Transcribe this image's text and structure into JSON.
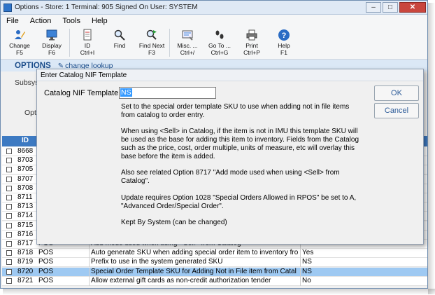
{
  "window": {
    "title": "Options - Store: 1   Terminal: 905   Signed On User: SYSTEM"
  },
  "menu": [
    "File",
    "Action",
    "Tools",
    "Help"
  ],
  "toolbar": [
    {
      "name": "change",
      "icon": "pencil-person-icon",
      "line1": "Change",
      "line2": "F5"
    },
    {
      "name": "display",
      "icon": "monitor-icon",
      "line1": "Display",
      "line2": "F6"
    },
    {
      "name": "id",
      "icon": "id-card-icon",
      "line1": "ID",
      "line2": "Ctrl+I"
    },
    {
      "name": "find",
      "icon": "magnifier-icon",
      "line1": "Find",
      "line2": ""
    },
    {
      "name": "find-next",
      "icon": "magnifier-arrow-icon",
      "line1": "Find Next",
      "line2": "F3"
    },
    {
      "name": "misc",
      "icon": "tools-icon",
      "line1": "Misc. ...",
      "line2": "Ctrl+/"
    },
    {
      "name": "goto",
      "icon": "footsteps-icon",
      "line1": "Go To ...",
      "line2": "Ctrl+G"
    },
    {
      "name": "print",
      "icon": "printer-icon",
      "line1": "Print",
      "line2": "Ctrl+P"
    },
    {
      "name": "help",
      "icon": "help-icon",
      "line1": "Help",
      "line2": "F1"
    }
  ],
  "options_bar": {
    "title": "OPTIONS",
    "link": "change lookup"
  },
  "background_labels": {
    "subsystem": "Subsyst",
    "option": "Opti"
  },
  "grid": {
    "headers": {
      "id": "ID"
    },
    "rows": [
      {
        "id": "8668",
        "sys": "",
        "desc": "",
        "val": ""
      },
      {
        "id": "8703",
        "sys": "",
        "desc": "",
        "val": ""
      },
      {
        "id": "8705",
        "sys": "",
        "desc": "",
        "val": ""
      },
      {
        "id": "8707",
        "sys": "",
        "desc": "",
        "val": ""
      },
      {
        "id": "8708",
        "sys": "",
        "desc": "",
        "val": ""
      },
      {
        "id": "8711",
        "sys": "",
        "desc": "",
        "val": ""
      },
      {
        "id": "8713",
        "sys": "",
        "desc": "",
        "val": ""
      },
      {
        "id": "8714",
        "sys": "",
        "desc": "",
        "val": ""
      },
      {
        "id": "8715",
        "sys": "",
        "desc": "",
        "val": ""
      },
      {
        "id": "8716",
        "sys": "",
        "desc": "",
        "val": ""
      },
      {
        "id": "8717",
        "sys": "POS",
        "desc": "Add mode used when using <Sell> from Catalog",
        "val": ""
      },
      {
        "id": "8718",
        "sys": "POS",
        "desc": "Auto generate SKU when adding special order item to inventory fro",
        "val": "Yes"
      },
      {
        "id": "8719",
        "sys": "POS",
        "desc": "Prefix to use in the system generated SKU",
        "val": "NS"
      },
      {
        "id": "8720",
        "sys": "POS",
        "desc": "Special Order Template SKU for Adding Not in File item from Catal",
        "val": "NS",
        "selected": true
      },
      {
        "id": "8721",
        "sys": "POS",
        "desc": "Allow external gift cards as non-credit authorization tender",
        "val": "No"
      }
    ]
  },
  "dialog": {
    "title": "Enter Catalog NIF Template",
    "field_label": "Catalog NIF Template",
    "field_value": "NS",
    "ok_label": "OK",
    "cancel_label": "Cancel",
    "paragraphs": [
      "Set to the special order template SKU to use when adding not in file items\nfrom catalog to order entry.",
      "When using <Sell> in Catalog, if the item is not in IMU this template SKU will\nbe used as the base for adding this item to inventory.  Fields from the Catalog\nsuch as the price, cost, order multiple, units of measure, etc will overlay this\nbase before the item is added.",
      "Also see related Option 8717 \"Add mode used when using <Sell> from\nCatalog\".",
      "Update requires Option 1028 \"Special Orders Allowed in RPOS\" be set to A,\n\"Advanced Order/Special Order\".",
      "Kept By System (can be changed)"
    ]
  },
  "colors": {
    "accent": "#1a4c8a",
    "grid_header": "#3d7ac2",
    "selection": "#9ec9f2"
  }
}
